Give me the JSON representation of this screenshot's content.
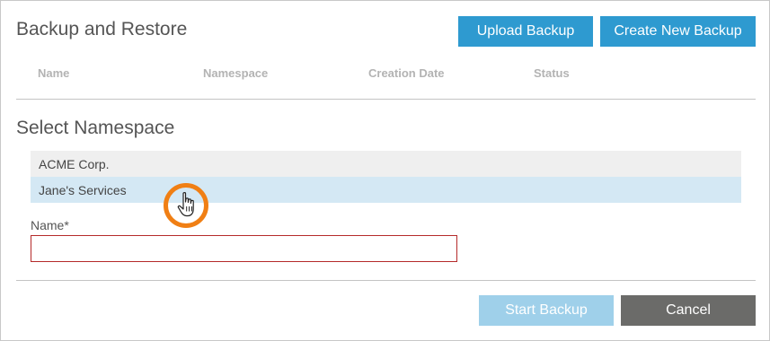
{
  "header": {
    "title": "Backup and Restore",
    "upload_label": "Upload Backup",
    "create_label": "Create New Backup"
  },
  "table": {
    "columns": [
      "Name",
      "Namespace",
      "Creation Date",
      "Status"
    ],
    "rows": []
  },
  "namespace_section": {
    "title": "Select Namespace",
    "items": [
      "ACME Corp.",
      "Jane's Services"
    ],
    "hovered_index": 1
  },
  "name_field": {
    "label": "Name*",
    "value": ""
  },
  "footer": {
    "start_label": "Start Backup",
    "cancel_label": "Cancel"
  },
  "colors": {
    "primary": "#2e9ad0",
    "primary_disabled": "#9fd0ea",
    "cancel": "#6b6b69",
    "hover_row": "#d4e8f4",
    "error_border": "#b52a2a",
    "cursor_highlight": "#f07f14"
  },
  "icons": {
    "cursor": "hand-pointer-icon"
  }
}
